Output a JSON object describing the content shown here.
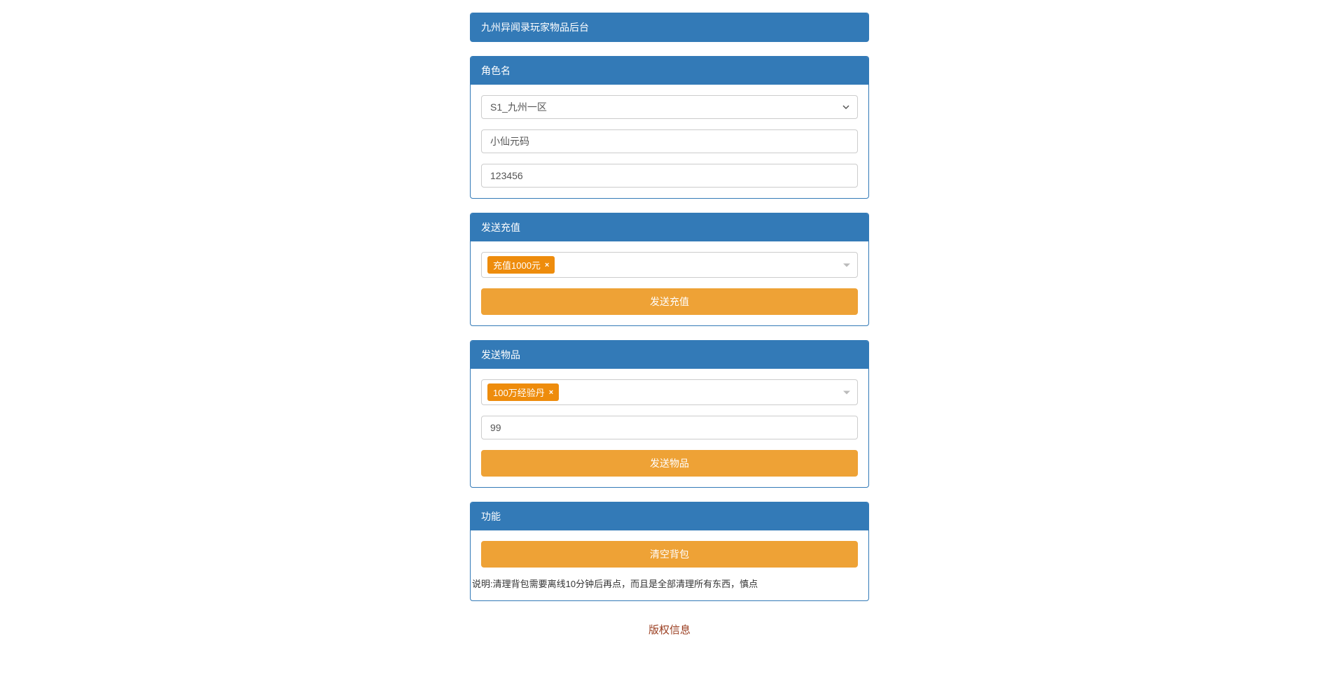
{
  "header": {
    "title": "九州异闻录玩家物品后台"
  },
  "rolePanel": {
    "title": "角色名",
    "serverSelect": "S1_九州一区",
    "nameValue": "小仙元码",
    "idValue": "123456"
  },
  "rechargePanel": {
    "title": "发送充值",
    "selectedTag": "充值1000元",
    "buttonLabel": "发送充值"
  },
  "itemPanel": {
    "title": "发送物品",
    "selectedTag": "100万经验丹",
    "quantityValue": "99",
    "buttonLabel": "发送物品"
  },
  "funcPanel": {
    "title": "功能",
    "clearBagLabel": "清空背包",
    "note": "说明:清理背包需要离线10分钟后再点，而且是全部清理所有东西，慎点"
  },
  "footer": {
    "text": "版权信息"
  }
}
